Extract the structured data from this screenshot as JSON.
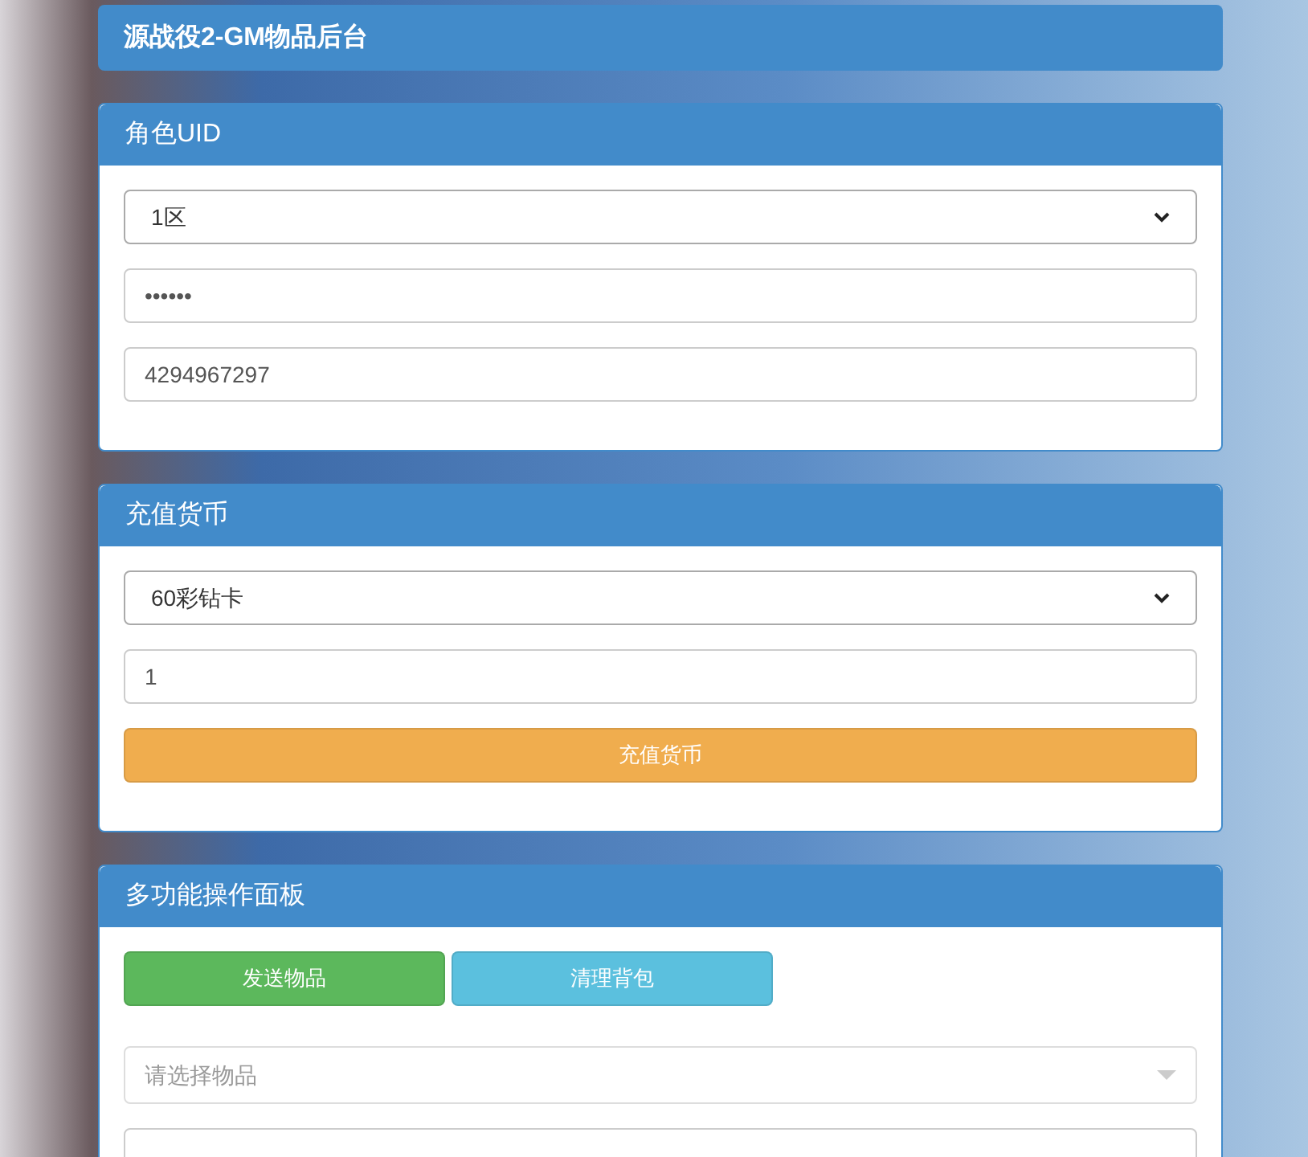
{
  "header": {
    "title": "源战役2-GM物品后台"
  },
  "panels": [
    {
      "title": "角色UID",
      "fields": [
        {
          "kind": "select",
          "value": "1区"
        },
        {
          "kind": "input",
          "value": "••••••"
        },
        {
          "kind": "input",
          "value": "4294967297"
        }
      ]
    },
    {
      "title": "充值货币",
      "fields": [
        {
          "kind": "select",
          "value": "60彩钻卡"
        },
        {
          "kind": "input",
          "value": "1"
        }
      ],
      "buttons": [
        {
          "kind": "wide",
          "label": "充值货币",
          "color": "#f0ad4e"
        }
      ]
    },
    {
      "title": "多功能操作面板",
      "buttons": [
        {
          "kind": "half",
          "label": "发送物品",
          "color": "#5cb85c"
        },
        {
          "kind": "half",
          "label": "清理背包",
          "color": "#5bc0de"
        }
      ],
      "fields": [
        {
          "kind": "combo",
          "placeholder": "请选择物品"
        },
        {
          "kind": "input"
        }
      ]
    }
  ]
}
